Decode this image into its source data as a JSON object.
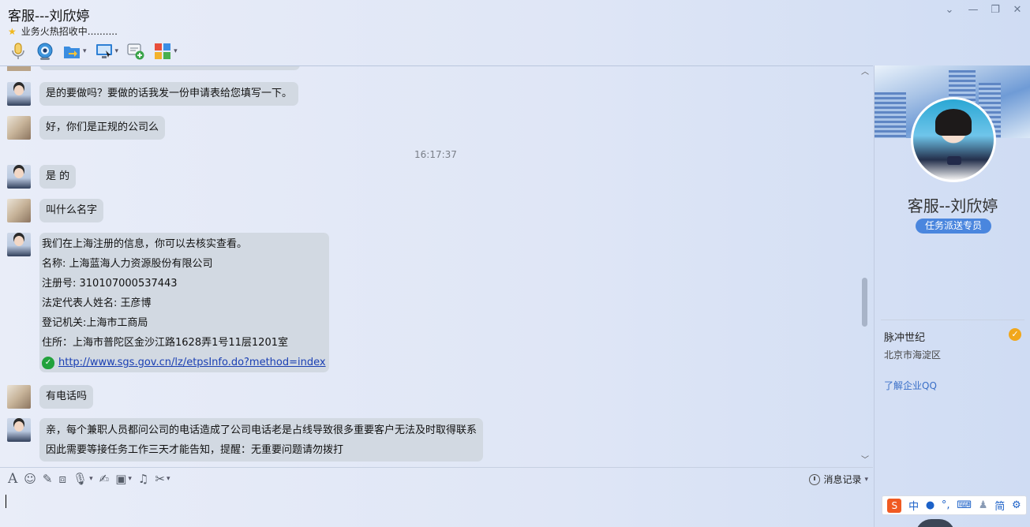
{
  "window": {
    "title": "客服---刘欣婷",
    "status": "业务火热招收中..........",
    "controls": {
      "dropdown": "⌄",
      "minimize": "—",
      "restore": "❐",
      "close": "✕"
    }
  },
  "toolbar": {
    "items": [
      {
        "icon": "microphone-icon",
        "color": "#d7a21f",
        "has_dropdown": false
      },
      {
        "icon": "video-camera-icon",
        "color": "#2e83cf",
        "has_dropdown": false
      },
      {
        "icon": "file-transfer-icon",
        "color": "#3b8de0",
        "has_dropdown": true
      },
      {
        "icon": "screen-share-icon",
        "color": "#2d7fd4",
        "has_dropdown": true
      },
      {
        "icon": "add-chat-icon",
        "color": "#3aa44a",
        "has_dropdown": false
      },
      {
        "icon": "apps-icon",
        "color": "#e8782b",
        "has_dropdown": true
      }
    ]
  },
  "chat": {
    "timestamp": "16:17:37",
    "messages": [
      {
        "sender": "agent",
        "text": "是的要做吗？要做的话我发一份申请表给您填写一下。"
      },
      {
        "sender": "user",
        "text": "好，你们是正规的公司么"
      },
      {
        "sender": "agent",
        "text": "是 的"
      },
      {
        "sender": "user",
        "text": "叫什么名字"
      },
      {
        "sender": "agent",
        "lines": [
          "我们在上海注册的信息，你可以去核实查看。",
          "名称: 上海蓝海人力资源股份有限公司",
          "注册号: 310107000537443",
          "法定代表人姓名: 王彦博",
          "登记机关:上海市工商局",
          "住所：上海市普陀区金沙江路1628弄1号11层1201室"
        ],
        "link": "http://www.sgs.gov.cn/lz/etpsInfo.do?method=index"
      },
      {
        "sender": "user",
        "text": "有电话吗"
      },
      {
        "sender": "agent",
        "lines": [
          "亲，每个兼职人员都问公司的电话造成了公司电话老是占线导致很多重要客户无法及时取得联系",
          "因此需要等接任务工作三天才能告知，提醒：无重要问题请勿拨打"
        ]
      }
    ]
  },
  "input_toolbar": {
    "icons": [
      "font-icon",
      "emoji-icon",
      "magic-wand-icon",
      "screenshot-icon",
      "voice-message-icon",
      "edit-icon",
      "image-icon",
      "music-icon",
      "scissors-icon"
    ],
    "history_label": "消息记录"
  },
  "profile": {
    "name": "客服--刘欣婷",
    "role": "任务派送专员",
    "company": "脉冲世纪",
    "location": "北京市海淀区",
    "link_label": "了解企业QQ"
  },
  "ime": {
    "logo": "S",
    "mode": "中",
    "simplified": "简"
  }
}
